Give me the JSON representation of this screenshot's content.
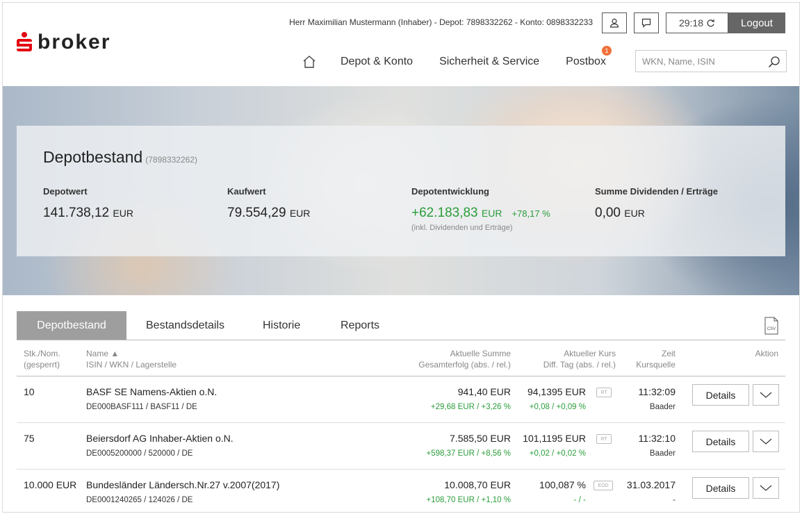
{
  "header": {
    "logo_text": "broker",
    "user_line": "Herr Maximilian Mustermann (Inhaber)  -  Depot: 7898332262  -  Konto: 0898332233",
    "timer": "29:18",
    "logout_label": "Logout",
    "nav": [
      "Depot & Konto",
      "Sicherheit & Service",
      "Postbox"
    ],
    "postbox_badge": "1",
    "search_placeholder": "WKN, Name, ISIN"
  },
  "summary": {
    "title": "Depotbestand",
    "depot_number": "(7898332262)",
    "depotwert": {
      "label": "Depotwert",
      "value": "141.738,12",
      "currency": "EUR"
    },
    "kaufwert": {
      "label": "Kaufwert",
      "value": "79.554,29",
      "currency": "EUR"
    },
    "entwicklung": {
      "label": "Depotentwicklung",
      "value": "+62.183,83",
      "currency": "EUR",
      "percent": "+78,17 %",
      "note": "(inkl. Dividenden und Erträge)"
    },
    "dividenden": {
      "label": "Summe Dividenden / Erträge",
      "value": "0,00",
      "currency": "EUR"
    }
  },
  "tabs": [
    "Depotbestand",
    "Bestandsdetails",
    "Historie",
    "Reports"
  ],
  "csv_label": "CSV",
  "columns": {
    "stk": "Stk./Nom.",
    "stk_sub": "(gesperrt)",
    "name": "Name ▲",
    "name_sub": "ISIN / WKN / Lagerstelle",
    "summe": "Aktuelle Summe",
    "summe_sub": "Gesamterfolg (abs. / rel.)",
    "kurs": "Aktueller Kurs",
    "kurs_sub": "Diff. Tag (abs. / rel.)",
    "zeit": "Zeit",
    "zeit_sub": "Kursquelle",
    "aktion": "Aktion"
  },
  "rows": [
    {
      "stk": "10",
      "name": "BASF SE Namens-Aktien o.N.",
      "isin": "DE000BASF111 / BASF11 / DE",
      "summe": "941,40 EUR",
      "erfolg": "+29,68 EUR / +3,26 %",
      "kurs": "94,1395 EUR",
      "tag": "RT",
      "diff": "+0,08 / +0,09 %",
      "zeit": "11:32:09",
      "quelle": "Baader",
      "details": "Details"
    },
    {
      "stk": "75",
      "name": "Beiersdorf AG Inhaber-Aktien o.N.",
      "isin": "DE0005200000 / 520000 / DE",
      "summe": "7.585,50 EUR",
      "erfolg": "+598,37 EUR / +8,56 %",
      "kurs": "101,1195 EUR",
      "tag": "RT",
      "diff": "+0,02 / +0,02 %",
      "zeit": "11:32:10",
      "quelle": "Baader",
      "details": "Details"
    },
    {
      "stk": "10.000 EUR",
      "name": "Bundesländer Ländersch.Nr.27 v.2007(2017)",
      "isin": "DE0001240265 / 124026 / DE",
      "summe": "10.008,70 EUR",
      "erfolg": "+108,70 EUR / +1,10 %",
      "kurs": "100,087 %",
      "tag": "EOD",
      "diff": "- / -",
      "zeit": "31.03.2017",
      "quelle": "-",
      "details": "Details"
    }
  ]
}
